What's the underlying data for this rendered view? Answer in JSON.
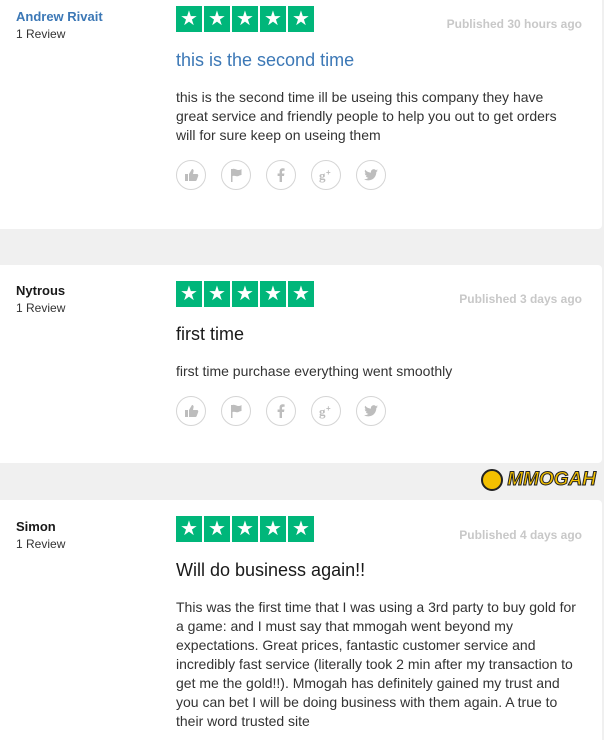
{
  "reviews": [
    {
      "author": "Andrew Rivait",
      "review_count": "1 Review",
      "rating": 5,
      "published": "Published 30 hours ago",
      "title": "this is the second time",
      "body": "this is the second time ill be useing this company they have great service and friendly people to help you out to get orders will for sure keep on useing them"
    },
    {
      "author": "Nytrous",
      "review_count": "1 Review",
      "rating": 5,
      "published": "Published 3 days ago",
      "title": "first time",
      "body": "first time purchase everything went smoothly"
    },
    {
      "author": "Simon",
      "review_count": "1 Review",
      "rating": 5,
      "published": "Published 4 days ago",
      "title": "Will do business again!!",
      "body": "This was the first time that I was using a 3rd party to buy gold for a game: and I must say that mmogah went beyond my expectations. Great prices, fantastic customer service and incredibly fast service (literally took 2 min after my transaction to get me the gold!!). Mmogah has definitely gained my trust and you can bet I will be doing business with them again. A true to their word trusted site"
    }
  ],
  "star_glyph": "★",
  "action_icons": [
    "thumbs-up-icon",
    "flag-icon",
    "facebook-icon",
    "google-plus-icon",
    "twitter-icon"
  ],
  "logo": {
    "text": "MMOGAH"
  },
  "colors": {
    "star_bg": "#00b67a",
    "link_blue": "#3c78b6",
    "logo_gold": "#f3c000"
  }
}
